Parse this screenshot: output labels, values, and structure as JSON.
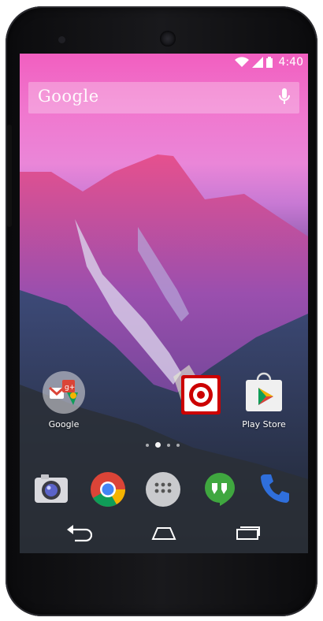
{
  "status_bar": {
    "time": "4:40"
  },
  "search": {
    "label": "Google"
  },
  "home_apps": [
    {
      "label": "Google"
    },
    {
      "label": ""
    },
    {
      "label": "Play Store"
    }
  ],
  "colors": {
    "status_text": "#ffffff",
    "google_blue": "#4285f4",
    "google_red": "#db4437",
    "google_yellow": "#f4b400",
    "google_green": "#0f9d58",
    "target_red": "#cc0000",
    "hangouts_green": "#3fa73f",
    "phone_blue": "#2f6fdc"
  },
  "icons": {
    "wifi": "wifi-icon",
    "signal": "signal-icon",
    "battery": "battery-icon",
    "mic": "mic-icon",
    "back": "back-icon",
    "home": "home-icon",
    "recents": "recents-icon"
  }
}
